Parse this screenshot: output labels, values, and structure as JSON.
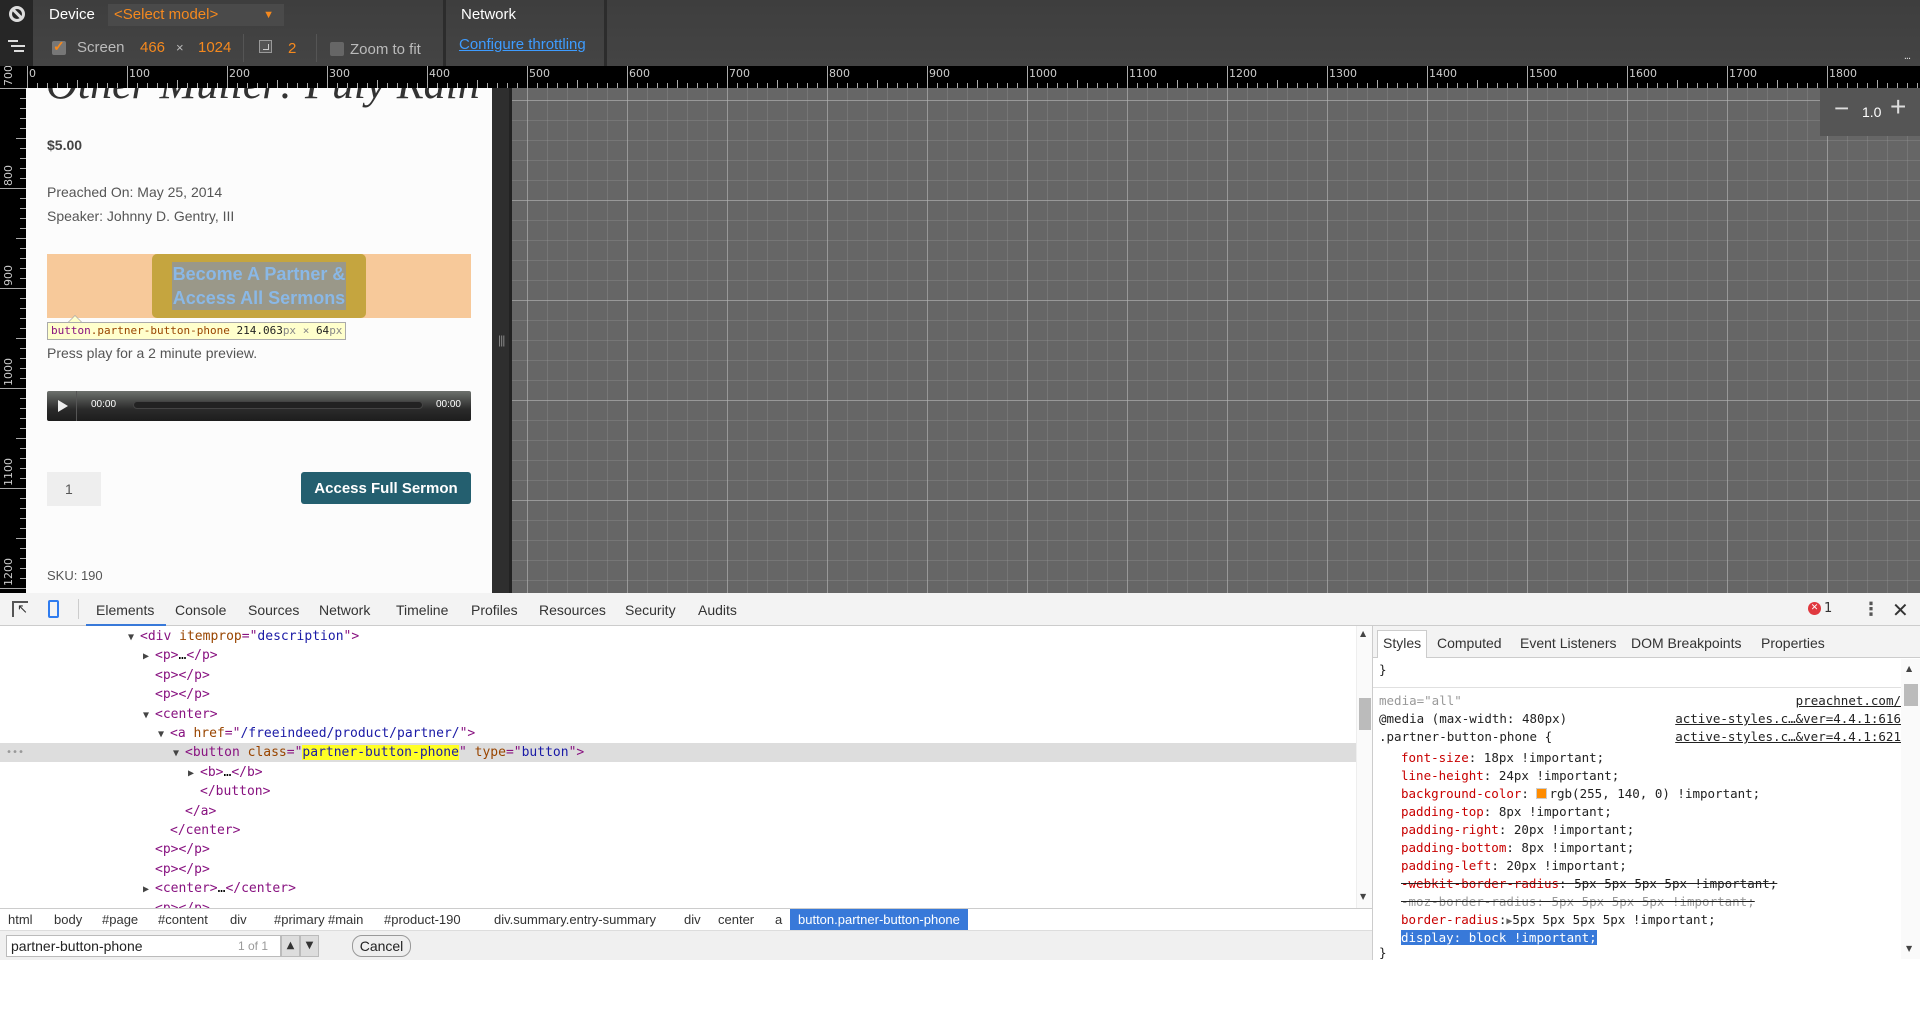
{
  "device_toolbar": {
    "device_label": "Device",
    "model_select": "<Select model>",
    "screen_label": "Screen",
    "screen_checked": true,
    "screen_width": "466",
    "times": "×",
    "screen_height": "1024",
    "device_pixel_ratio": "2",
    "zoom_to_fit_label": "Zoom to fit",
    "zoom_to_fit_checked": false,
    "network_label": "Network",
    "throttle_link": "Configure throttling",
    "more": "..."
  },
  "rulers": {
    "horizontal_labels": [
      "0",
      "100",
      "200",
      "300",
      "400",
      "500",
      "600",
      "700",
      "800",
      "900",
      "1000",
      "1100",
      "1200",
      "1300",
      "1400",
      "1500",
      "1600",
      "1700",
      "1800"
    ],
    "vertical_labels": [
      "700",
      "800",
      "900",
      "1000",
      "1100",
      "1200"
    ]
  },
  "zoom_control": {
    "minus": "−",
    "value": "1.0",
    "plus": "+"
  },
  "page": {
    "title_fragment": "Other Muller: Puly Rain",
    "price": "$5.00",
    "preached_on": "Preached On: May 25, 2014",
    "speaker": "Speaker: Johnny D. Gentry, III",
    "partner_button": "Become A Partner & Access All Sermons",
    "tooltip": {
      "tag": "button",
      "class": ".partner-button-phone",
      "width": "214.063",
      "height": "64",
      "unit": "px",
      "times": "×"
    },
    "preview_text": "Press play for a 2 minute preview.",
    "player": {
      "current_time": "00:00",
      "duration": "00:00",
      "progress": 0
    },
    "quantity": "1",
    "access_button": "Access Full Sermon",
    "sku": "SKU: 190"
  },
  "devtools": {
    "tabs": [
      "Elements",
      "Console",
      "Sources",
      "Network",
      "Timeline",
      "Profiles",
      "Resources",
      "Security",
      "Audits"
    ],
    "active_tab": "Elements",
    "error_count": "1",
    "dom_lines": [
      {
        "indent": 0,
        "tri": "▼",
        "parts": [
          [
            "tag",
            "<div "
          ],
          [
            "attr",
            "itemprop"
          ],
          [
            "tag",
            "=\""
          ],
          [
            "val",
            "description"
          ],
          [
            "tag",
            "\">"
          ]
        ]
      },
      {
        "indent": 1,
        "tri": "▶",
        "parts": [
          [
            "tag",
            "<p>"
          ],
          [
            "plain",
            "…"
          ],
          [
            "tag",
            "</p>"
          ]
        ]
      },
      {
        "indent": 1,
        "tri": "",
        "parts": [
          [
            "tag",
            "<p></p>"
          ]
        ]
      },
      {
        "indent": 1,
        "tri": "",
        "parts": [
          [
            "tag",
            "<p></p>"
          ]
        ]
      },
      {
        "indent": 1,
        "tri": "▼",
        "parts": [
          [
            "tag",
            "<center>"
          ]
        ]
      },
      {
        "indent": 2,
        "tri": "▼",
        "parts": [
          [
            "tag",
            "<a "
          ],
          [
            "attr",
            "href"
          ],
          [
            "tag",
            "=\""
          ],
          [
            "val",
            "/freeindeed/product/partner/"
          ],
          [
            "tag",
            "\">"
          ]
        ]
      },
      {
        "indent": 3,
        "tri": "▼",
        "selected": true,
        "parts": [
          [
            "tag",
            "<button "
          ],
          [
            "attr",
            "class"
          ],
          [
            "tag",
            "=\""
          ],
          [
            "hl",
            "partner-button-phone"
          ],
          [
            "tag",
            "\" "
          ],
          [
            "attr",
            "type"
          ],
          [
            "tag",
            "=\""
          ],
          [
            "val",
            "button"
          ],
          [
            "tag",
            "\">"
          ]
        ]
      },
      {
        "indent": 4,
        "tri": "▶",
        "parts": [
          [
            "tag",
            "<b>"
          ],
          [
            "plain",
            "…"
          ],
          [
            "tag",
            "</b>"
          ]
        ]
      },
      {
        "indent": 4,
        "tri": "",
        "parts": [
          [
            "tag",
            "</button>"
          ]
        ]
      },
      {
        "indent": 3,
        "tri": "",
        "parts": [
          [
            "tag",
            "</a>"
          ]
        ]
      },
      {
        "indent": 2,
        "tri": "",
        "parts": [
          [
            "tag",
            "</center>"
          ]
        ]
      },
      {
        "indent": 1,
        "tri": "",
        "parts": [
          [
            "tag",
            "<p></p>"
          ]
        ]
      },
      {
        "indent": 1,
        "tri": "",
        "parts": [
          [
            "tag",
            "<p></p>"
          ]
        ]
      },
      {
        "indent": 1,
        "tri": "▶",
        "parts": [
          [
            "tag",
            "<center>"
          ],
          [
            "plain",
            "…"
          ],
          [
            "tag",
            "</center>"
          ]
        ]
      },
      {
        "indent": 1,
        "tri": "",
        "parts": [
          [
            "tag",
            "<p></p>"
          ]
        ]
      }
    ],
    "breadcrumbs": [
      "html",
      "body",
      "#page",
      "#content",
      "div",
      "#primary",
      "#main",
      "#product-190",
      "div.summary.entry-summary",
      "div",
      "center",
      "a",
      "button.partner-button-phone"
    ],
    "search": {
      "value": "partner-button-phone",
      "count": "1 of 1",
      "cancel": "Cancel"
    },
    "styles_tabs": [
      "Styles",
      "Computed",
      "Event Listeners",
      "DOM Breakpoints",
      "Properties"
    ],
    "styles": {
      "closing_brace_top": "}",
      "media_attr": "media=\"all\"",
      "media_src": "preachnet.com/",
      "media_query": "@media (max-width: 480px)",
      "media_query_src": "active-styles.c…&ver=4.4.1:616",
      "selector": ".partner-button-phone {",
      "selector_src": "active-styles.c…&ver=4.4.1:621",
      "declarations": [
        {
          "prop": "font-size",
          "value": "18px !important;"
        },
        {
          "prop": "line-height",
          "value": "24px !important;"
        },
        {
          "prop": "background-color",
          "value": "rgb(255, 140, 0) !important;",
          "swatch": "#ff8c00"
        },
        {
          "prop": "padding-top",
          "value": "8px !important;"
        },
        {
          "prop": "padding-right",
          "value": "20px !important;"
        },
        {
          "prop": "padding-bottom",
          "value": "8px !important;"
        },
        {
          "prop": "padding-left",
          "value": "20px !important;"
        },
        {
          "prop": "-webkit-border-radius",
          "value": "5px 5px 5px 5px !important;",
          "struck": true
        },
        {
          "prop": "-moz-border-radius",
          "value": "5px 5px 5px 5px !important;",
          "struck": true,
          "inactive": true
        },
        {
          "prop": "border-radius",
          "value": "5px 5px 5px 5px !important;",
          "expand": true
        },
        {
          "prop": "display",
          "value": "block !important;",
          "selected": true
        }
      ],
      "closing_brace": "}"
    }
  },
  "colors": {
    "accent_orange": "#f5891e",
    "link_blue": "#3e9cff",
    "devtools_blue": "#3879d9",
    "access_button": "#245f6f"
  }
}
